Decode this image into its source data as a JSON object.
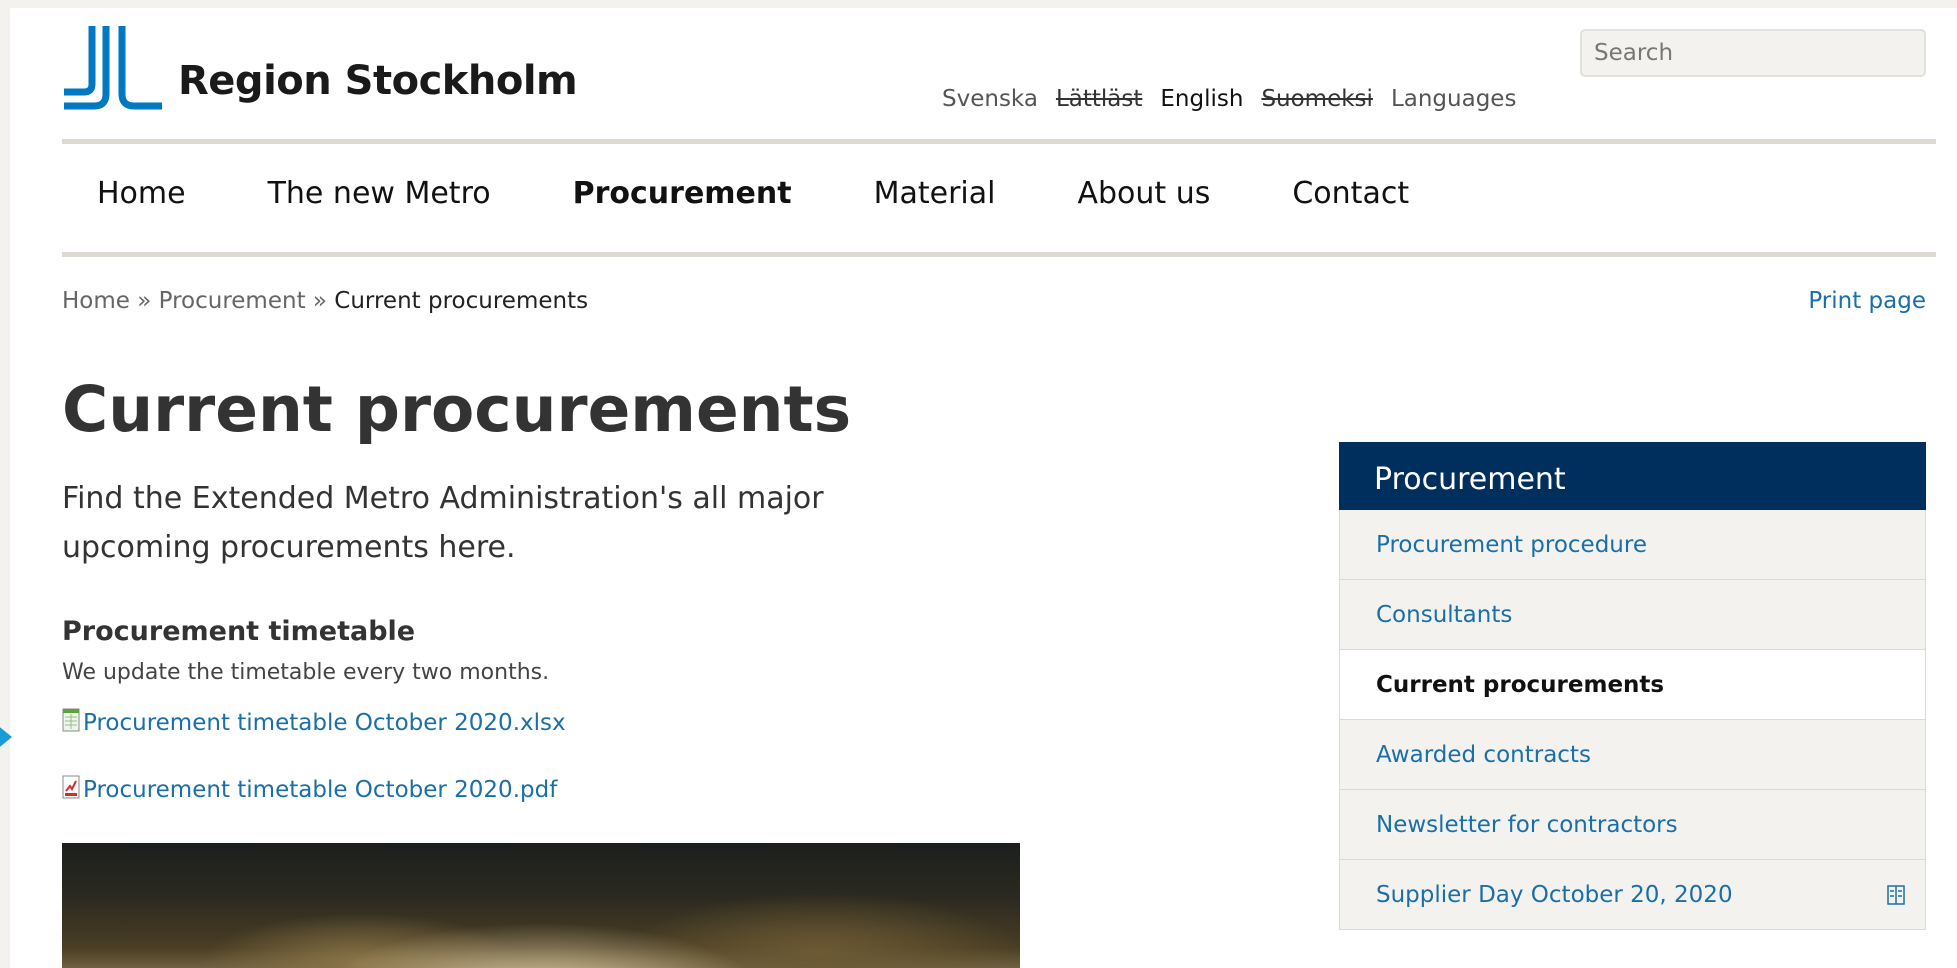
{
  "header": {
    "logo_text": "Region Stockholm",
    "brand_color": "#0079c2",
    "languages": [
      {
        "label": "Svenska",
        "style": "normal"
      },
      {
        "label": "Lättläst",
        "style": "strikethrough"
      },
      {
        "label": "English",
        "style": "active"
      },
      {
        "label": "Suomeksi",
        "style": "strikethrough"
      },
      {
        "label": "Languages",
        "style": "normal"
      }
    ],
    "search_placeholder": "Search"
  },
  "nav": {
    "items": [
      "Home",
      "The new Metro",
      "Procurement",
      "Material",
      "About us",
      "Contact"
    ],
    "current": "Procurement"
  },
  "breadcrumb": {
    "home": "Home",
    "sep1": "»",
    "section": "Procurement",
    "sep2": "»",
    "current": "Current procurements"
  },
  "print_label": "Print page",
  "main": {
    "title": "Current procurements",
    "intro": "Find the Extended Metro Administration's all major upcoming procurements here.",
    "subheading": "Procurement timetable",
    "subtext": "We update the timetable every two months.",
    "files": [
      {
        "label": "Procurement timetable October 2020.xlsx",
        "icon": "excel-file-icon"
      },
      {
        "label": "Procurement timetable October 2020.pdf",
        "icon": "pdf-file-icon"
      }
    ]
  },
  "sidebar": {
    "heading": "Procurement",
    "heading_color": "#002e5d",
    "items": [
      {
        "label": "Procurement procedure"
      },
      {
        "label": "Consultants"
      },
      {
        "label": "Current procurements",
        "active": true
      },
      {
        "label": "Awarded contracts"
      },
      {
        "label": "Newsletter for contractors"
      },
      {
        "label": "Supplier Day October 20, 2020",
        "external_icon": "external-link-icon"
      }
    ]
  }
}
